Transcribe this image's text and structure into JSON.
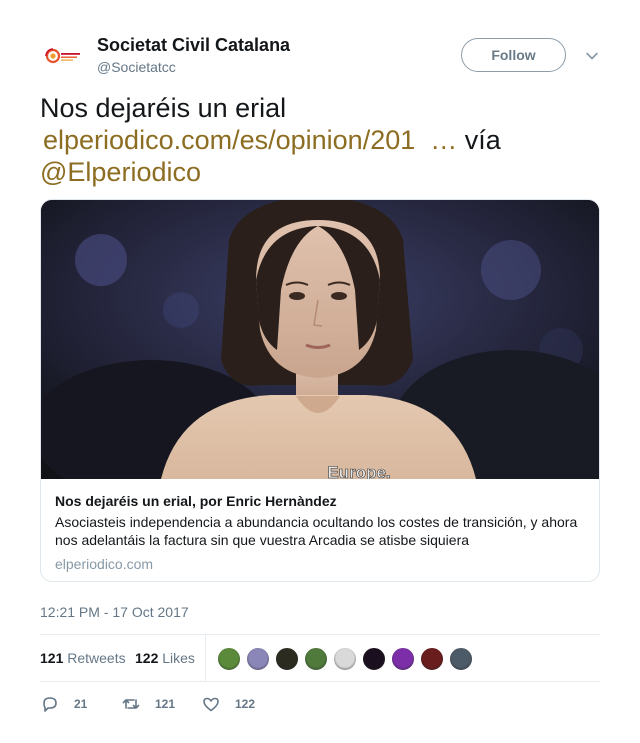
{
  "account": {
    "display_name": "Societat Civil Catalana",
    "handle": "@Societatcc",
    "avatar_icon": "societat-civil-catalana-logo"
  },
  "follow_label": "Follow",
  "tweet": {
    "text_plain": "Nos dejaréis un erial",
    "link_text": "elperiodico.com/es/opinion/201",
    "ellipsis": "…",
    "via_text": "vía",
    "mention": "@Elperiodico"
  },
  "card": {
    "image_caption": "Europe.",
    "title": "Nos dejaréis un erial, por Enric Hernàndez",
    "description": "Asociasteis independencia a abundancia ocultando los costes de transición, y ahora nos adelantáis la factura sin que vuestra Arcadia se atisbe siquiera",
    "domain": "elperiodico.com"
  },
  "timestamp": "12:21 PM - 17 Oct 2017",
  "stats": {
    "retweets_count": "121",
    "retweets_label": "Retweets",
    "likes_count": "122",
    "likes_label": "Likes"
  },
  "likers": [
    {
      "name": "liker-avatar-1",
      "color": "#5a8a3a"
    },
    {
      "name": "liker-avatar-2",
      "color": "#8a86b8"
    },
    {
      "name": "liker-avatar-3",
      "color": "#2b2b20"
    },
    {
      "name": "liker-avatar-4",
      "color": "#4f7a3c"
    },
    {
      "name": "liker-avatar-5",
      "color": "#d9d9d9"
    },
    {
      "name": "liker-avatar-6",
      "color": "#1a0f1e"
    },
    {
      "name": "liker-avatar-7",
      "color": "#7b2ea8"
    },
    {
      "name": "liker-avatar-8",
      "color": "#6a1d1d"
    },
    {
      "name": "liker-avatar-9",
      "color": "#4d5a68"
    }
  ],
  "actions": {
    "reply_count": "21",
    "retweet_count": "121",
    "like_count": "122"
  },
  "colors": {
    "link": "#8c6d22",
    "secondary_text": "#657786",
    "border": "#e1e8ed"
  }
}
